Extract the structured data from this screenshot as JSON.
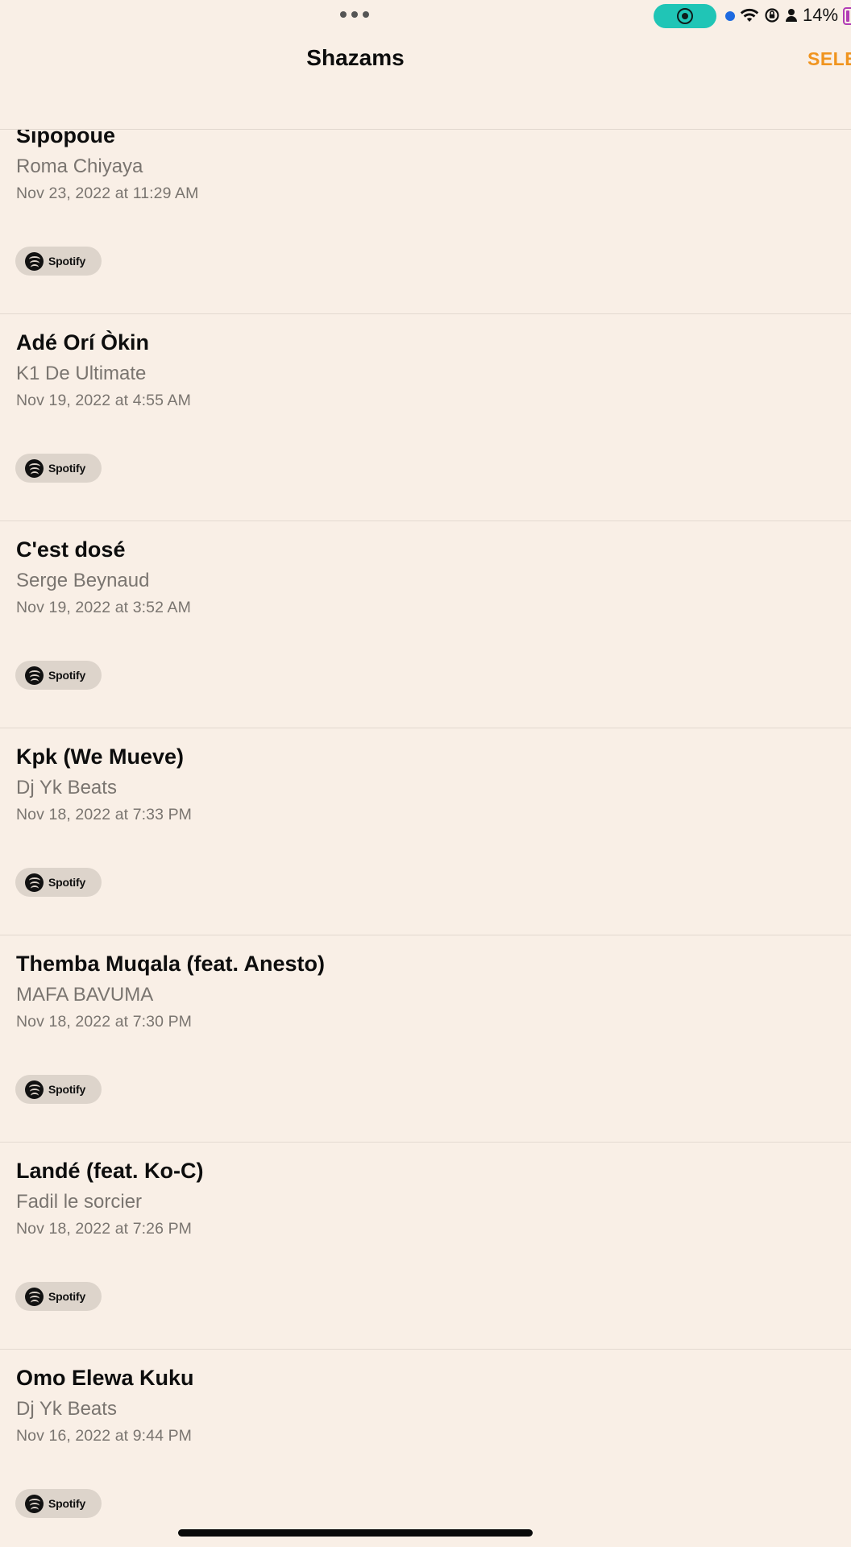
{
  "status_bar": {
    "battery_percent": "14%",
    "icons": [
      "multitask-dots-icon",
      "screen-record-icon",
      "location-dot-icon",
      "wifi-icon",
      "orientation-lock-icon",
      "person-icon",
      "battery-icon"
    ],
    "colors": {
      "record_pill": "#20c5b6",
      "dot": "#1e6ae0",
      "battery": "#b13cb6"
    }
  },
  "nav": {
    "title": "Shazams",
    "select_label": "SELE"
  },
  "theme": {
    "background": "#f9efe6",
    "accent": "#f0941f"
  },
  "items": [
    {
      "title": "Sipopoue",
      "artist": "Roma Chiyaya",
      "date": "Nov 23, 2022 at 11:29 AM",
      "service": "Spotify"
    },
    {
      "title": "Adé Orí Òkin",
      "artist": "K1 De Ultimate",
      "date": "Nov 19, 2022 at 4:55 AM",
      "service": "Spotify"
    },
    {
      "title": "C'est dosé",
      "artist": "Serge Beynaud",
      "date": "Nov 19, 2022 at 3:52 AM",
      "service": "Spotify"
    },
    {
      "title": "Kpk (We Mueve)",
      "artist": "Dj Yk Beats",
      "date": "Nov 18, 2022 at 7:33 PM",
      "service": "Spotify"
    },
    {
      "title": "Themba Muqala (feat. Anesto)",
      "artist": "MAFA BAVUMA",
      "date": "Nov 18, 2022 at 7:30 PM",
      "service": "Spotify"
    },
    {
      "title": "Landé (feat. Ko-C)",
      "artist": "Fadil le sorcier",
      "date": "Nov 18, 2022 at 7:26 PM",
      "service": "Spotify"
    },
    {
      "title": "Omo Elewa Kuku",
      "artist": "Dj Yk Beats",
      "date": "Nov 16, 2022 at 9:44 PM",
      "service": "Spotify"
    }
  ]
}
